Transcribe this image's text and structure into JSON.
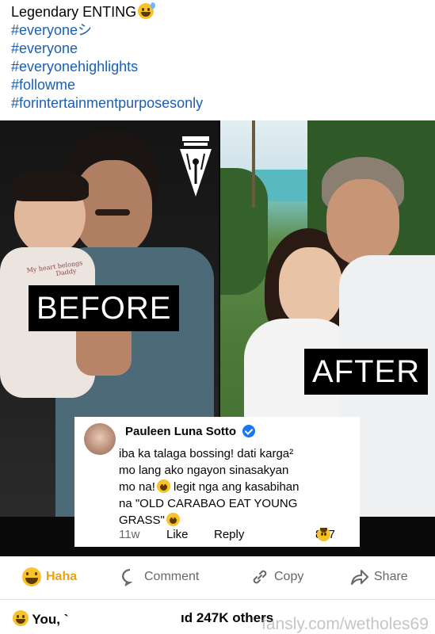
{
  "caption": {
    "title": "Legendary ENTING",
    "hashtags": [
      "#everyoneシ",
      "#everyone",
      "#everyonehighlights",
      "#followme",
      "#forintertainmentpurposesonly"
    ]
  },
  "media": {
    "left_label": "BEFORE",
    "right_label": "AFTER",
    "shirt_text_line1": "My heart belongs",
    "shirt_text_line2": "Daddy"
  },
  "comment": {
    "author": "Pauleen Luna Sotto",
    "text_line1": "iba ka talaga bossing! dati karga²",
    "text_line2": "mo lang ako ngayon sinasakyan",
    "text_line3": "mo na!",
    "text_line3b": " legit nga ang kasabihan",
    "text_line4": "na \"OLD CARABAO EAT YOUNG",
    "text_line5": "GRASS\"",
    "time": "11w",
    "like": "Like",
    "reply": "Reply",
    "reaction_count": "857"
  },
  "actions": {
    "haha": "Haha",
    "comment": "Comment",
    "copy": "Copy",
    "share": "Share"
  },
  "reactions": {
    "prefix": "You, `",
    "suffix": "ıd 247K others"
  },
  "watermark": "fansly.com/wetholes69",
  "colors": {
    "hashtag": "#1a5fb4",
    "haha": "#f0a10a",
    "verified": "#1877f2"
  }
}
